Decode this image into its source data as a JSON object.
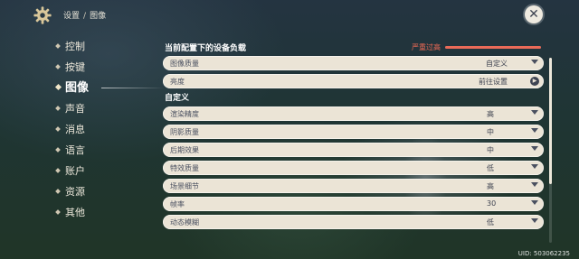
{
  "header": {
    "breadcrumb": [
      "设置",
      "图像"
    ],
    "separator": "/"
  },
  "icons": {
    "settings": "gear-icon",
    "close": "close-icon",
    "navigate": "chevron-right-icon",
    "dropdown": "chevron-down-icon"
  },
  "sidebar": {
    "items": [
      {
        "label": "控制",
        "active": false
      },
      {
        "label": "按键",
        "active": false
      },
      {
        "label": "图像",
        "active": true
      },
      {
        "label": "声音",
        "active": false
      },
      {
        "label": "消息",
        "active": false
      },
      {
        "label": "语言",
        "active": false
      },
      {
        "label": "账户",
        "active": false
      },
      {
        "label": "资源",
        "active": false
      },
      {
        "label": "其他",
        "active": false
      }
    ]
  },
  "load": {
    "title": "当前配置下的设备负载",
    "status": "严重过高",
    "level": 1.0,
    "color": "#ea6a58"
  },
  "top_settings": [
    {
      "label": "图像质量",
      "value": "自定义"
    },
    {
      "label": "亮度",
      "value": "前往设置"
    }
  ],
  "custom": {
    "title": "自定义",
    "settings": [
      {
        "label": "渲染精度",
        "value": "高"
      },
      {
        "label": "阴影质量",
        "value": "中"
      },
      {
        "label": "后期效果",
        "value": "中"
      },
      {
        "label": "特效质量",
        "value": "低"
      },
      {
        "label": "场景细节",
        "value": "高"
      },
      {
        "label": "帧率",
        "value": "30"
      },
      {
        "label": "动态模糊",
        "value": "低"
      }
    ]
  },
  "footer": {
    "uid": "UID: 503062235"
  },
  "colors": {
    "row_bg": "#ebe4d6",
    "row_text": "#4a5060",
    "warning": "#f06a55"
  }
}
